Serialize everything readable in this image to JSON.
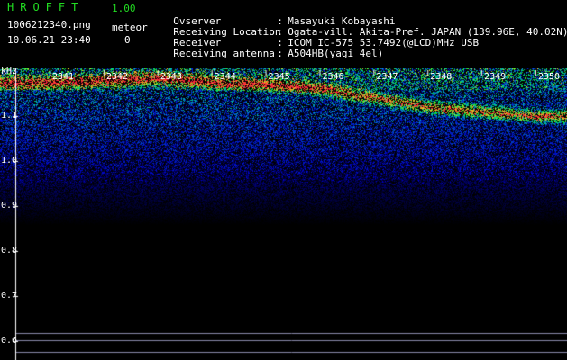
{
  "header": {
    "app_name": "HROFFT",
    "app_version": "1.00",
    "filename": "1006212340.png",
    "meteor_label": "meteor",
    "datetime": "10.06.21 23:40",
    "meteor_count": "0"
  },
  "info": [
    {
      "key": "Ovserver",
      "sep": ":",
      "value": "Masayuki Kobayashi"
    },
    {
      "key": "Receiving Location",
      "sep": ":",
      "value": "Ogata-vill. Akita-Pref. JAPAN (139.96E, 40.02N)"
    },
    {
      "key": "Receiver",
      "sep": ":",
      "value": "ICOM IC-575 53.7492(@LCD)MHz USB"
    },
    {
      "key": "Receiving antenna",
      "sep": ":",
      "value": "A504HB(yagi 4el)"
    }
  ],
  "colors": {
    "header_green": "#22dd22",
    "grid_line": "#8888aa"
  },
  "chart_data": {
    "type": "heatmap",
    "ylabel": "kHz",
    "y_ticks": [
      1.1,
      1.0,
      0.9,
      0.8,
      0.7,
      0.6
    ],
    "y_tick_labels": [
      "1.1",
      "1.0",
      "0.9",
      "0.8",
      "0.7",
      "0.6"
    ],
    "x_tick_labels": [
      "2341",
      "2342",
      "2343",
      "2344",
      "2345",
      "2346",
      "2347",
      "2348",
      "2349",
      "2350"
    ],
    "x_unit": "minutes (HHMM)",
    "ylim": [
      0.58,
      1.2
    ],
    "signal_band": [
      {
        "x": "2341",
        "center_khz": 1.175
      },
      {
        "x": "2342",
        "center_khz": 1.18
      },
      {
        "x": "2343",
        "center_khz": 1.185
      },
      {
        "x": "2344",
        "center_khz": 1.175
      },
      {
        "x": "2345",
        "center_khz": 1.17
      },
      {
        "x": "2346",
        "center_khz": 1.16
      },
      {
        "x": "2347",
        "center_khz": 1.14
      },
      {
        "x": "2348",
        "center_khz": 1.12
      },
      {
        "x": "2349",
        "center_khz": 1.11
      },
      {
        "x": "2350",
        "center_khz": 1.1
      }
    ],
    "grid": false
  }
}
